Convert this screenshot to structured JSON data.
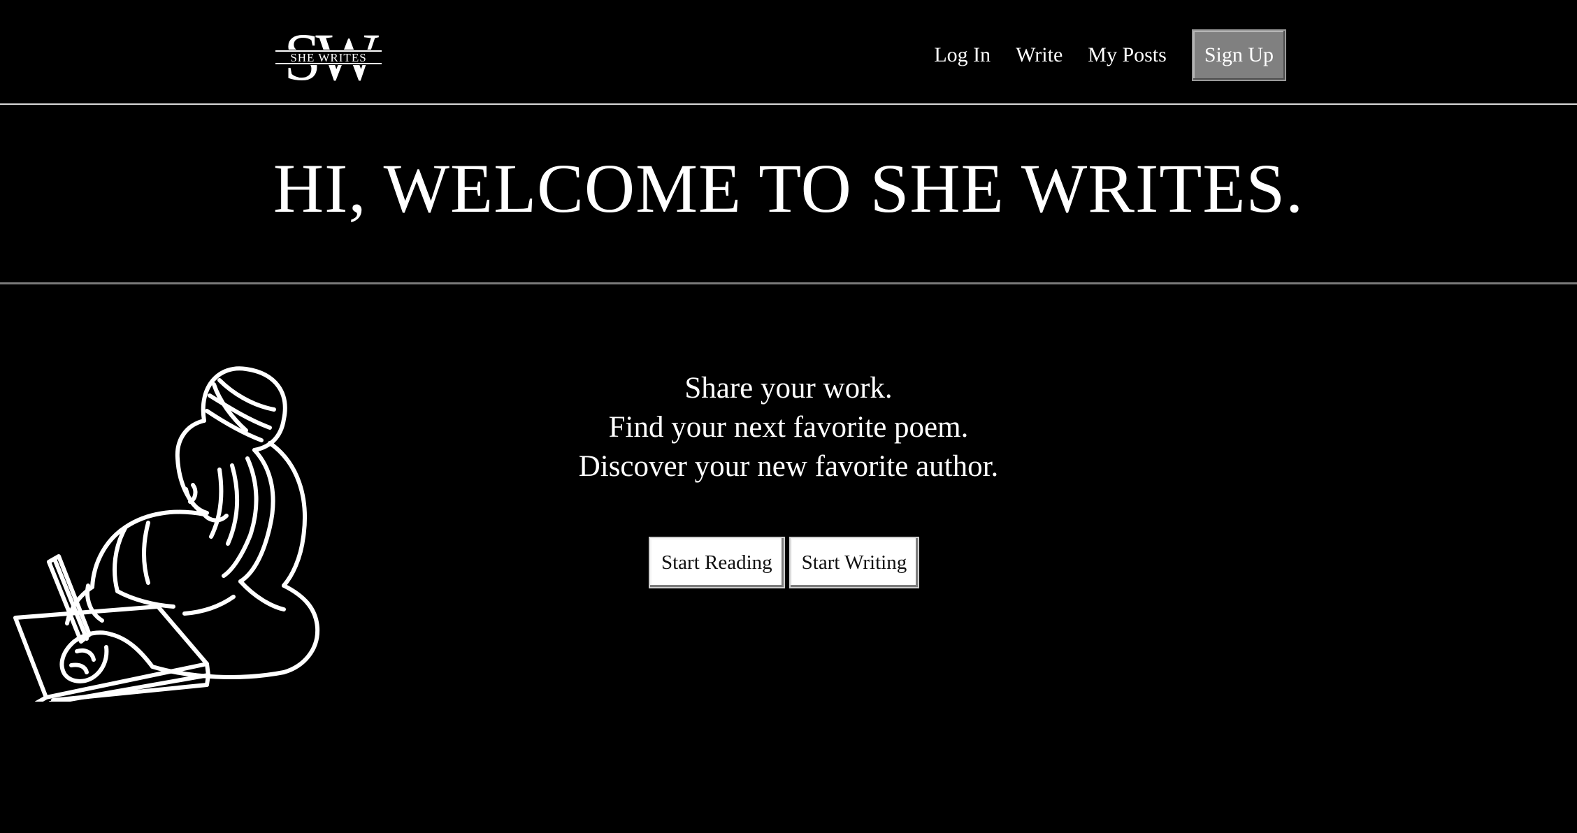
{
  "header": {
    "logo": {
      "monogram": "SW",
      "wordmark": "SHE WRITES"
    },
    "nav": {
      "login": "Log In",
      "write": "Write",
      "my_posts": "My Posts",
      "signup": "Sign Up"
    }
  },
  "hero": {
    "title": "HI, WELCOME TO SHE WRITES."
  },
  "main": {
    "tagline": [
      "Share your work.",
      "Find your next favorite poem.",
      "Discover your new favorite author."
    ],
    "buttons": {
      "start_reading": "Start Reading",
      "start_writing": "Start Writing"
    },
    "illustration": "woman-writing-illustration"
  },
  "colors": {
    "background": "#000000",
    "text": "#ffffff",
    "signup_button": "#808080",
    "action_button": "#ffffff"
  }
}
